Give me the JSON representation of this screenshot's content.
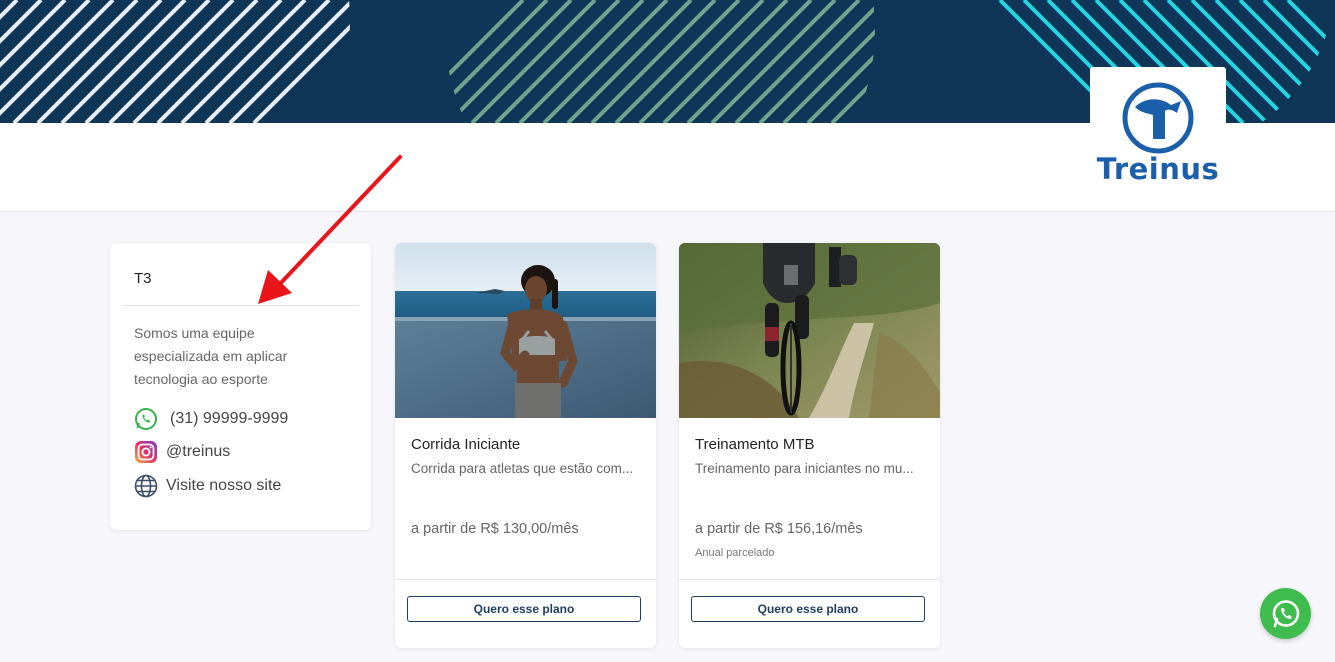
{
  "brand": {
    "name": "Treinus",
    "color": "#1b5ea9",
    "banner_color": "#0f3557"
  },
  "team": {
    "name": "T3",
    "description": "Somos uma equipe especializada em aplicar tecnologia ao esporte",
    "contacts": [
      {
        "icon": "whatsapp-icon",
        "text": "(31) 99999-9999"
      },
      {
        "icon": "instagram-icon",
        "text": "@treinus"
      },
      {
        "icon": "globe-icon",
        "text": "Visite nosso site"
      }
    ]
  },
  "plans": [
    {
      "name": "Corrida Iniciante",
      "description": "Corrida para atletas que estão com...",
      "price": "a partir de R$ 130,00/mês",
      "note": "",
      "button": "Quero esse plano"
    },
    {
      "name": "Treinamento MTB",
      "description": "Treinamento para iniciantes no mu...",
      "price": "a partir de R$ 156,16/mês",
      "note": "Anual parcelado",
      "button": "Quero esse plano"
    }
  ],
  "annotation_color": "#e8161b",
  "whatsapp_color": "#3ebd4e"
}
